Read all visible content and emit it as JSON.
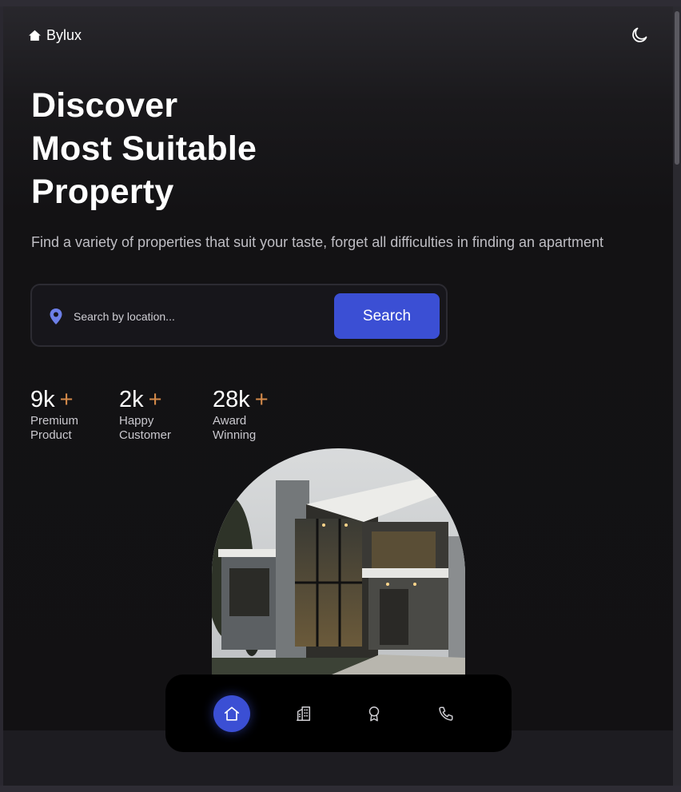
{
  "header": {
    "brand": "Bylux",
    "brand_icon": "home-icon",
    "theme_icon": "moon-icon"
  },
  "hero": {
    "headline_lines": [
      "Discover",
      "Most Suitable",
      "Property"
    ],
    "subtitle": "Find a variety of properties that suit your taste, forget all difficulties in finding an apartment"
  },
  "search": {
    "icon": "location-pin-icon",
    "placeholder": "Search by location...",
    "value": "",
    "button_label": "Search"
  },
  "stats": [
    {
      "value": "9k",
      "suffix": "+",
      "label": "Premium Product"
    },
    {
      "value": "2k",
      "suffix": "+",
      "label": "Happy Customer"
    },
    {
      "value": "28k",
      "suffix": "+",
      "label": "Award Winning"
    }
  ],
  "nav": [
    {
      "name": "home",
      "icon": "home-icon",
      "active": true
    },
    {
      "name": "buildings",
      "icon": "building-icon",
      "active": false
    },
    {
      "name": "awards",
      "icon": "award-icon",
      "active": false
    },
    {
      "name": "contact",
      "icon": "phone-icon",
      "active": false
    }
  ],
  "colors": {
    "accent": "#3b4fd4",
    "plus": "#d48a4a",
    "background": "#131214"
  }
}
